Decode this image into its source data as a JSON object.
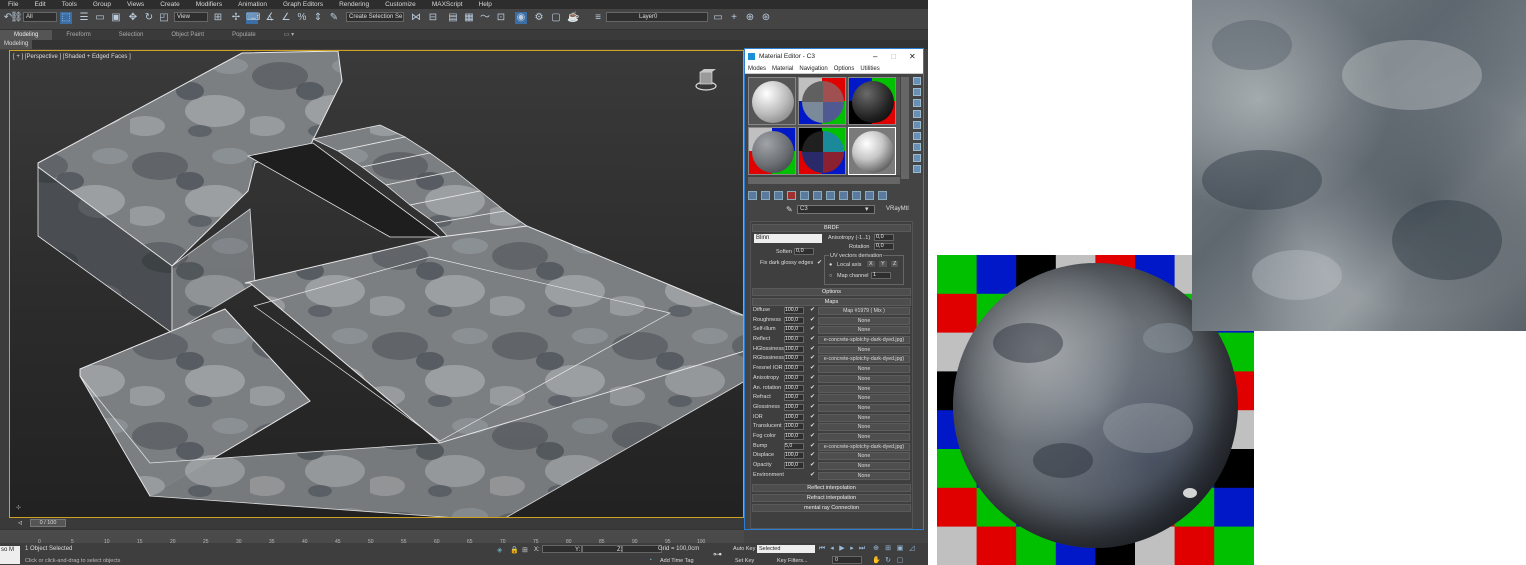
{
  "menubar": [
    "File",
    "Edit",
    "Tools",
    "Group",
    "Views",
    "Create",
    "Modifiers",
    "Animation",
    "Graph Editors",
    "Rendering",
    "Customize",
    "MAXScript",
    "Help"
  ],
  "main_toolbar": {
    "filter_value": "All",
    "view_value": "View",
    "selection_set_placeholder": "Create Selection Se",
    "layer_value": "Layer0"
  },
  "ribbon": {
    "tabs": [
      "Modeling",
      "Freeform",
      "Selection",
      "Object Paint",
      "Populate"
    ],
    "active_tab": "Modeling",
    "subtab": "Modeling"
  },
  "viewport": {
    "label": "[ + ] [Perspective ] [Shaded + Edged Faces ]"
  },
  "timeline": {
    "slider_label": "0 / 100",
    "ticks": [
      "0",
      "5",
      "10",
      "15",
      "20",
      "25",
      "30",
      "35",
      "40",
      "45",
      "50",
      "55",
      "60",
      "65",
      "70",
      "75",
      "80",
      "85",
      "90",
      "95",
      "100"
    ]
  },
  "statusbar": {
    "selection": "1 Object Selected",
    "prompt": "Click or click-and-drag to select objects",
    "maxscript": "so M",
    "coord_x_label": "X:",
    "coord_y_label": "Y:",
    "coord_z_label": "Z:",
    "grid": "Grid = 100,0cm",
    "add_time_tag": "Add Time Tag",
    "auto_key": "Auto Key",
    "set_key": "Set Key",
    "key_mode_value": "Selected",
    "key_filters": "Key Filters...",
    "frame_value": "0"
  },
  "material_editor": {
    "title": "Material Editor - C3",
    "menu": [
      "Modes",
      "Material",
      "Navigation",
      "Options",
      "Utilities"
    ],
    "material_name": "C3",
    "material_type": "VRayMtl",
    "brdf": {
      "header": "BRDF",
      "type_value": "Blinn",
      "anisotropy_label": "Anisotropy (-1..1)",
      "anisotropy_value": "0,0",
      "rotation_label": "Rotation",
      "rotation_value": "0,0",
      "soften_label": "Soften",
      "soften_value": "0,0",
      "fix_dark_label": "Fix dark glossy edges",
      "uv_group_label": "UV vectors derivation",
      "local_axis_label": "Local axis",
      "axis_x": "X",
      "axis_y": "Y",
      "axis_z": "Z",
      "map_channel_label": "Map channel",
      "map_channel_value": "1"
    },
    "options_header": "Options",
    "maps_header": "Maps",
    "maps": [
      {
        "name": "Diffuse",
        "value": "100,0",
        "map": "Map #1979 ( Mix )"
      },
      {
        "name": "Roughness",
        "value": "100,0",
        "map": "None"
      },
      {
        "name": "Self-illum",
        "value": "100,0",
        "map": "None"
      },
      {
        "name": "Reflect",
        "value": "100,0",
        "map": "e-concrete-splotchy-dark-dyed.jpg)"
      },
      {
        "name": "HGlossiness",
        "value": "100,0",
        "map": "None"
      },
      {
        "name": "RGlossiness",
        "value": "100,0",
        "map": "e-concrete-splotchy-dark-dyed.jpg)"
      },
      {
        "name": "Fresnel IOR",
        "value": "100,0",
        "map": "None"
      },
      {
        "name": "Anisotropy",
        "value": "100,0",
        "map": "None"
      },
      {
        "name": "An. rotation",
        "value": "100,0",
        "map": "None"
      },
      {
        "name": "Refract",
        "value": "100,0",
        "map": "None"
      },
      {
        "name": "Glossiness",
        "value": "100,0",
        "map": "None"
      },
      {
        "name": "IOR",
        "value": "100,0",
        "map": "None"
      },
      {
        "name": "Translucent",
        "value": "100,0",
        "map": "None"
      },
      {
        "name": "Fog color",
        "value": "100,0",
        "map": "None"
      },
      {
        "name": "Bump",
        "value": "5,0",
        "map": "e-concrete-splotchy-dark-dyed.jpg)"
      },
      {
        "name": "Displace",
        "value": "100,0",
        "map": "None"
      },
      {
        "name": "Opacity",
        "value": "100,0",
        "map": "None"
      },
      {
        "name": "Environment",
        "value": "",
        "map": "None"
      }
    ],
    "rollouts_bottom": [
      "Reflect interpolation",
      "Refract interpolation",
      "mental ray Connection"
    ]
  },
  "colors": {
    "viewport_border": "#d0a020",
    "window_border": "#2a7fd4",
    "checker_red": "#e00000",
    "checker_green": "#00c000",
    "checker_blue": "#0018c8",
    "checker_black": "#000000",
    "checker_gray": "#c0c0c0"
  }
}
